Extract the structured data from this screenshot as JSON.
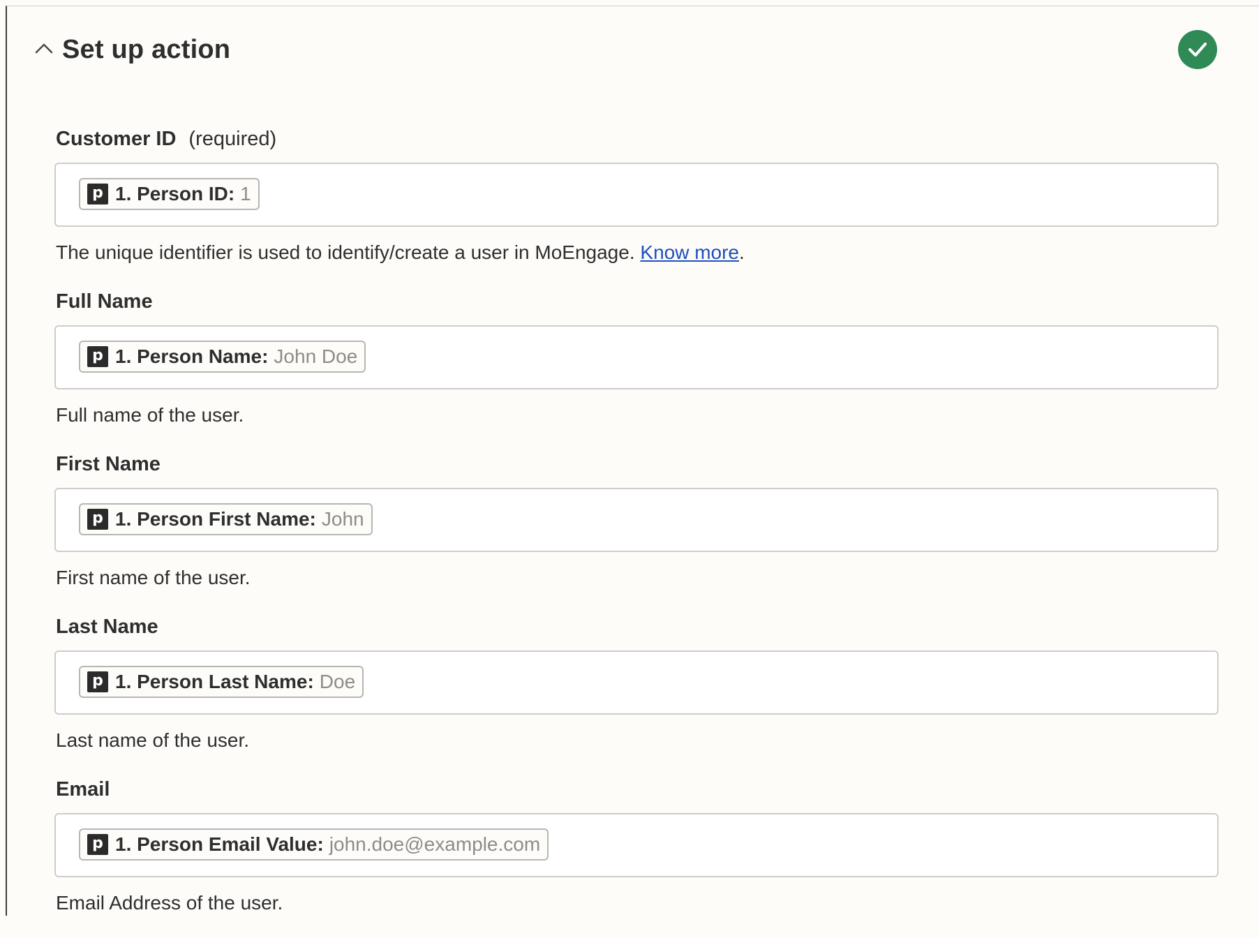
{
  "header": {
    "title": "Set up action",
    "collapse_icon": "chevron-up-icon",
    "status_icon": "check-circle-icon",
    "status_color": "#2f8a55"
  },
  "app": {
    "icon_letter": "p",
    "icon_name": "pipedrive-app-icon"
  },
  "fields": [
    {
      "label": "Customer ID",
      "required_label": "(required)",
      "pill_label": "1. Person ID:",
      "pill_value": "1",
      "help_text": "The unique identifier is used to identify/create a user in MoEngage. ",
      "help_link": "Know more",
      "help_suffix": "."
    },
    {
      "label": "Full Name",
      "pill_label": "1. Person Name:",
      "pill_value": "John Doe",
      "help_text": "Full name of the user."
    },
    {
      "label": "First Name",
      "pill_label": "1. Person First Name:",
      "pill_value": "John",
      "help_text": "First name of the user."
    },
    {
      "label": "Last Name",
      "pill_label": "1. Person Last Name:",
      "pill_value": "Doe",
      "help_text": "Last name of the user."
    },
    {
      "label": "Email",
      "pill_label": "1. Person Email Value:",
      "pill_value": "john.doe@example.com",
      "help_text": "Email Address of the user."
    }
  ],
  "colors": {
    "link": "#1f4fbf",
    "text": "#2d2e2e",
    "muted": "#8e8c89",
    "background": "#fdfcf9"
  }
}
